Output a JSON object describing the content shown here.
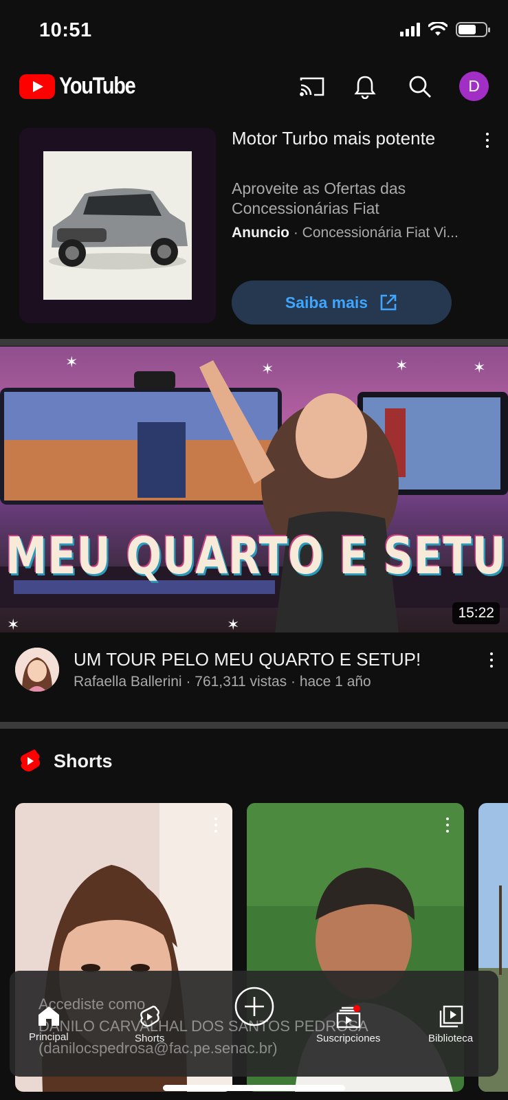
{
  "status_bar": {
    "time": "10:51"
  },
  "header": {
    "logo_text": "YouTube",
    "avatar_letter": "D"
  },
  "ad": {
    "title": "Motor Turbo mais potente",
    "description": "Aproveite as Ofertas das Concessionárias Fiat",
    "label": "Anuncio",
    "advertiser": "Concessionária Fiat Vi...",
    "cta_label": "Saiba mais"
  },
  "video": {
    "thumbnail_text": "MEU QUARTO E SETUP",
    "duration": "15:22",
    "title": "UM TOUR PELO MEU QUARTO E SETUP!",
    "channel": "Rafaella Ballerini",
    "views": "761,311 vistas",
    "age": "hace 1 año"
  },
  "shorts": {
    "title": "Shorts"
  },
  "toast": {
    "line1": "Accediste como",
    "line2": "DANILO CARVALHAL DOS SANTOS PEDROSA",
    "line3": "(danilocspedrosa@fac.pe.senac.br)"
  },
  "bottom_nav": {
    "items": [
      {
        "label": "Principal",
        "icon": "home-icon"
      },
      {
        "label": "Shorts",
        "icon": "shorts-icon"
      },
      {
        "label": "",
        "icon": "create-icon"
      },
      {
        "label": "Suscripciones",
        "icon": "subscriptions-icon"
      },
      {
        "label": "Biblioteca",
        "icon": "library-icon"
      }
    ]
  },
  "colors": {
    "background": "#0f0f0f",
    "brand_red": "#ff0000",
    "cta_blue": "#3ea6ff",
    "avatar": "#a22fc5"
  }
}
